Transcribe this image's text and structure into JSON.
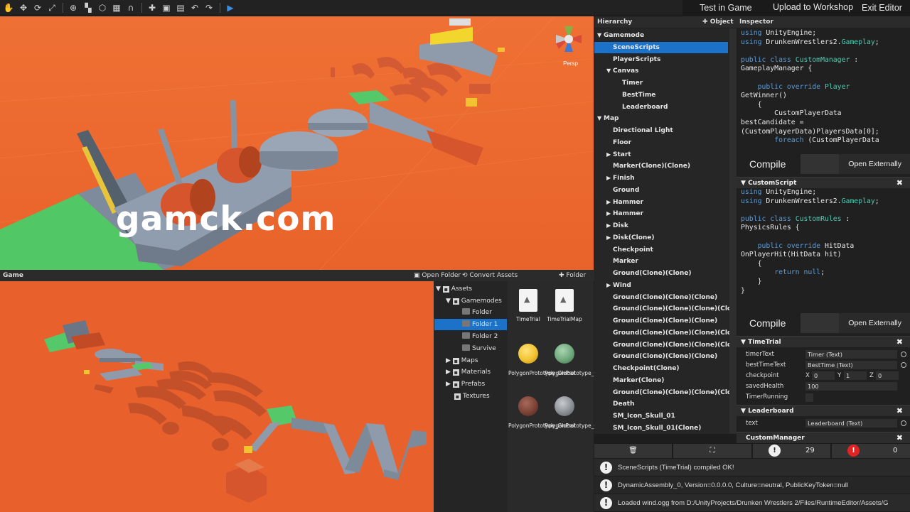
{
  "toolbar": {
    "tools": [
      "hand-tool-icon",
      "move-tool-icon",
      "rotate-tool-icon",
      "scale-tool-icon",
      "globe-icon",
      "pivot-icon",
      "hexagon-icon",
      "grid-icon",
      "magnet-icon",
      "add-icon",
      "save-icon",
      "save-as-icon",
      "undo-icon",
      "redo-icon",
      "play-icon"
    ],
    "test_in_game": "Test in Game",
    "upload": "Upload to Workshop",
    "exit": "Exit Editor"
  },
  "scene": {
    "persp_label": "Persp",
    "watermark": "gamck.com",
    "colors": {
      "ground": "#ec6a2f",
      "track": "#8d9aab",
      "obstacle": "#d8562c",
      "green": "#55c96a"
    }
  },
  "game": {
    "title": "Game"
  },
  "project": {
    "open_folder": "Open Folder",
    "convert": "Convert Assets",
    "add_folder": "Folder",
    "tree": [
      {
        "label": "Assets",
        "depth": 0,
        "expanded": true,
        "type": "pack"
      },
      {
        "label": "Gamemodes",
        "depth": 1,
        "expanded": true,
        "type": "pack"
      },
      {
        "label": "Folder",
        "depth": 2,
        "type": "folder"
      },
      {
        "label": "Folder 1",
        "depth": 2,
        "type": "folder",
        "selected": true
      },
      {
        "label": "Folder 2",
        "depth": 2,
        "type": "folder"
      },
      {
        "label": "Survive",
        "depth": 2,
        "type": "folder"
      },
      {
        "label": "Maps",
        "depth": 1,
        "expanded": false,
        "type": "pack"
      },
      {
        "label": "Materials",
        "depth": 1,
        "expanded": false,
        "type": "pack"
      },
      {
        "label": "Prefabs",
        "depth": 1,
        "expanded": false,
        "type": "pack"
      },
      {
        "label": "Textures",
        "depth": 1,
        "type": "pack"
      }
    ],
    "assets": [
      {
        "label": "TimeTrial",
        "kind": "doc"
      },
      {
        "label": "TimeTrialMap",
        "kind": "doc"
      },
      {
        "label": "PolygonPrototype_Global",
        "kind": "ball",
        "color": "#f2c230"
      },
      {
        "label": "PolygonPrototype_Global",
        "kind": "ball",
        "color": "#6fa87b"
      },
      {
        "label": "PolygonPrototype_Global",
        "kind": "ball",
        "color": "#7a4335"
      },
      {
        "label": "PolygonPrototype_Global",
        "kind": "ball",
        "color": "#8a8f94"
      }
    ]
  },
  "hierarchy": {
    "title": "Hierarchy",
    "add_object": "Object",
    "rows": [
      {
        "label": "Gamemode",
        "depth": 0,
        "arrow": "down"
      },
      {
        "label": "SceneScripts",
        "depth": 1,
        "selected": true
      },
      {
        "label": "PlayerScripts",
        "depth": 1
      },
      {
        "label": "Canvas",
        "depth": 1,
        "arrow": "down"
      },
      {
        "label": "Timer",
        "depth": 2
      },
      {
        "label": "BestTime",
        "depth": 2
      },
      {
        "label": "Leaderboard",
        "depth": 2
      },
      {
        "label": "Map",
        "depth": 0,
        "arrow": "down"
      },
      {
        "label": "Directional Light",
        "depth": 1
      },
      {
        "label": "Floor",
        "depth": 1
      },
      {
        "label": "Start",
        "depth": 1,
        "arrow": "right"
      },
      {
        "label": "Marker(Clone)(Clone)",
        "depth": 1
      },
      {
        "label": "Finish",
        "depth": 1,
        "arrow": "right"
      },
      {
        "label": "Ground",
        "depth": 1
      },
      {
        "label": "Hammer",
        "depth": 1,
        "arrow": "right"
      },
      {
        "label": "Hammer",
        "depth": 1,
        "arrow": "right"
      },
      {
        "label": "Disk",
        "depth": 1,
        "arrow": "right"
      },
      {
        "label": "Disk(Clone)",
        "depth": 1,
        "arrow": "right"
      },
      {
        "label": "Checkpoint",
        "depth": 1
      },
      {
        "label": "Marker",
        "depth": 1
      },
      {
        "label": "Ground(Clone)(Clone)",
        "depth": 1
      },
      {
        "label": "Wind",
        "depth": 1,
        "arrow": "right"
      },
      {
        "label": "Ground(Clone)(Clone)(Clone)",
        "depth": 1
      },
      {
        "label": "Ground(Clone)(Clone)(Clone)(Clone)",
        "depth": 1
      },
      {
        "label": "Ground(Clone)(Clone)(Clone)",
        "depth": 1
      },
      {
        "label": "Ground(Clone)(Clone)(Clone)(Clone)(Clone)",
        "depth": 1
      },
      {
        "label": "Ground(Clone)(Clone)(Clone)(Clone)",
        "depth": 1
      },
      {
        "label": "Ground(Clone)(Clone)(Clone)",
        "depth": 1
      },
      {
        "label": "Checkpoint(Clone)",
        "depth": 1
      },
      {
        "label": "Marker(Clone)",
        "depth": 1
      },
      {
        "label": "Ground(Clone)(Clone)(Clone)(Clone)",
        "depth": 1
      },
      {
        "label": "Death",
        "depth": 1
      },
      {
        "label": "SM_Icon_Skull_01",
        "depth": 1
      },
      {
        "label": "SM_Icon_Skull_01(Clone)",
        "depth": 1
      }
    ]
  },
  "inspector": {
    "title": "Inspector",
    "compile_label": "Compile",
    "open_externally": "Open Externally",
    "custom_script_title": "CustomScript",
    "timetrial": {
      "title": "TimeTrial",
      "timer_text_label": "timerText",
      "timer_text_value": "Timer (Text)",
      "best_time_label": "bestTimeText",
      "best_time_value": "BestTime (Text)",
      "checkpoint_label": "checkpoint",
      "x_label": "X",
      "x_value": "0",
      "y_label": "Y",
      "y_value": "1",
      "z_label": "Z",
      "z_value": "0",
      "health_label": "savedHealth",
      "health_value": "100",
      "running_label": "TimerRunning"
    },
    "leaderboard": {
      "title": "Leaderboard",
      "text_label": "text",
      "text_value": "Leaderboard (Text)"
    },
    "custom_manager_title": "CustomManager"
  },
  "console": {
    "warning_count": "29",
    "error_count": "0",
    "logs": [
      "SceneScripts (TimeTrial) compiled OK!",
      "DynamicAssembly_0, Version=0.0.0.0, Culture=neutral, PublicKeyToken=null",
      "Loaded wind.ogg from D:/UnityProjects/Drunken Wrestlers 2/Files/RuntimeEditor/Assets/G"
    ]
  }
}
